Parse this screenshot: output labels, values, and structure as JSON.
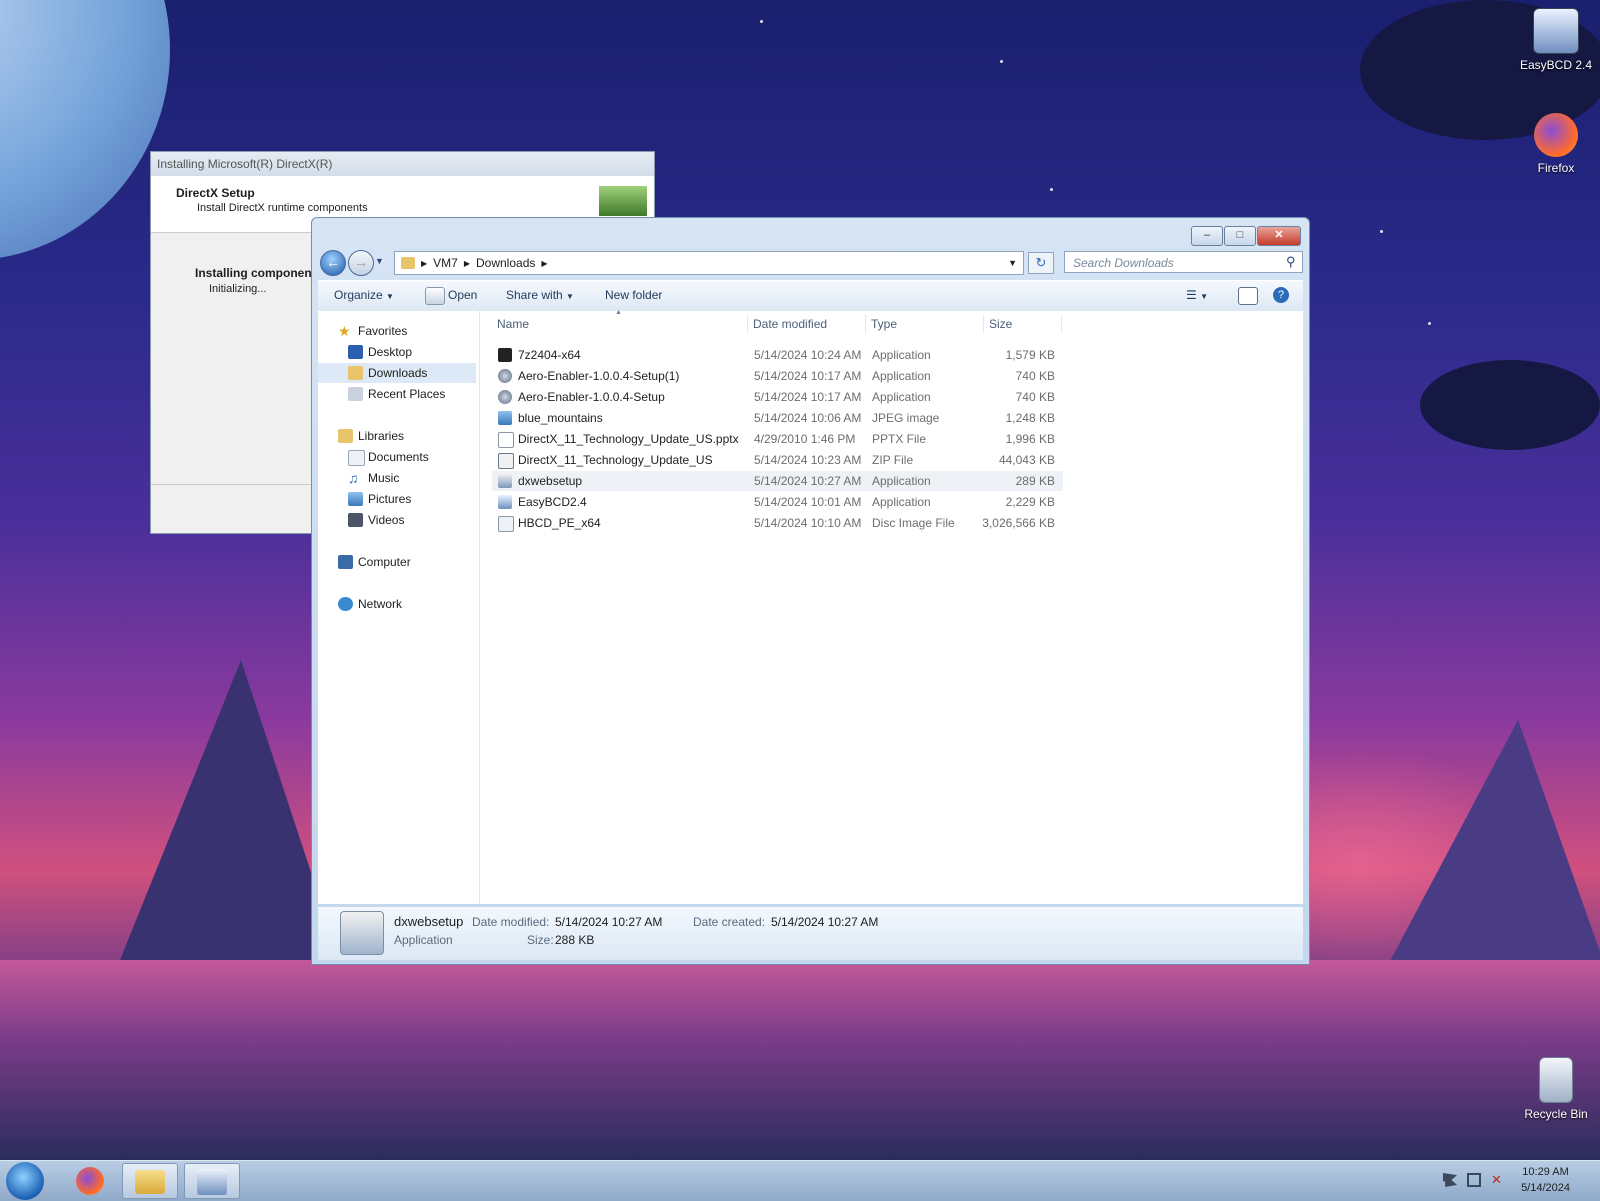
{
  "desktop": {
    "icons": [
      {
        "label": "EasyBCD 2.4"
      },
      {
        "label": "Firefox"
      },
      {
        "label": "Recycle Bin"
      }
    ]
  },
  "directx": {
    "title": "Installing Microsoft(R) DirectX(R)",
    "header_title": "DirectX Setup",
    "header_subtitle": "Install DirectX runtime components",
    "status_title": "Installing component",
    "status_text": "Initializing..."
  },
  "explorer": {
    "caption_buttons": {
      "minimize": "–",
      "maximize": "□",
      "close": "✕"
    },
    "breadcrumb": [
      "VM7",
      "Downloads"
    ],
    "search_placeholder": "Search Downloads",
    "commands": {
      "organize": "Organize",
      "open": "Open",
      "share_with": "Share with",
      "new_folder": "New folder"
    },
    "nav": {
      "favorites": "Favorites",
      "desktop": "Desktop",
      "downloads": "Downloads",
      "recent_places": "Recent Places",
      "libraries": "Libraries",
      "documents": "Documents",
      "music": "Music",
      "pictures": "Pictures",
      "videos": "Videos",
      "computer": "Computer",
      "network": "Network"
    },
    "columns": {
      "name": "Name",
      "date": "Date modified",
      "type": "Type",
      "size": "Size"
    },
    "files": [
      {
        "name": "7z2404-x64",
        "date": "5/14/2024 10:24 AM",
        "type": "Application",
        "size": "1,579 KB"
      },
      {
        "name": "Aero-Enabler-1.0.0.4-Setup(1)",
        "date": "5/14/2024 10:17 AM",
        "type": "Application",
        "size": "740 KB"
      },
      {
        "name": "Aero-Enabler-1.0.0.4-Setup",
        "date": "5/14/2024 10:17 AM",
        "type": "Application",
        "size": "740 KB"
      },
      {
        "name": "blue_mountains",
        "date": "5/14/2024 10:06 AM",
        "type": "JPEG image",
        "size": "1,248 KB"
      },
      {
        "name": "DirectX_11_Technology_Update_US.pptx",
        "date": "4/29/2010 1:46 PM",
        "type": "PPTX File",
        "size": "1,996 KB"
      },
      {
        "name": "DirectX_11_Technology_Update_US",
        "date": "5/14/2024 10:23 AM",
        "type": "ZIP File",
        "size": "44,043 KB"
      },
      {
        "name": "dxwebsetup",
        "date": "5/14/2024 10:27 AM",
        "type": "Application",
        "size": "289 KB"
      },
      {
        "name": "EasyBCD2.4",
        "date": "5/14/2024 10:01 AM",
        "type": "Application",
        "size": "2,229 KB"
      },
      {
        "name": "HBCD_PE_x64",
        "date": "5/14/2024 10:10 AM",
        "type": "Disc Image File",
        "size": "3,026,566 KB"
      }
    ],
    "details": {
      "name": "dxwebsetup",
      "type": "Application",
      "date_modified_label": "Date modified:",
      "date_modified": "5/14/2024 10:27 AM",
      "size_label": "Size:",
      "size": "288 KB",
      "date_created_label": "Date created:",
      "date_created": "5/14/2024 10:27 AM"
    }
  },
  "taskbar": {
    "time": "10:29 AM",
    "date": "5/14/2024"
  }
}
